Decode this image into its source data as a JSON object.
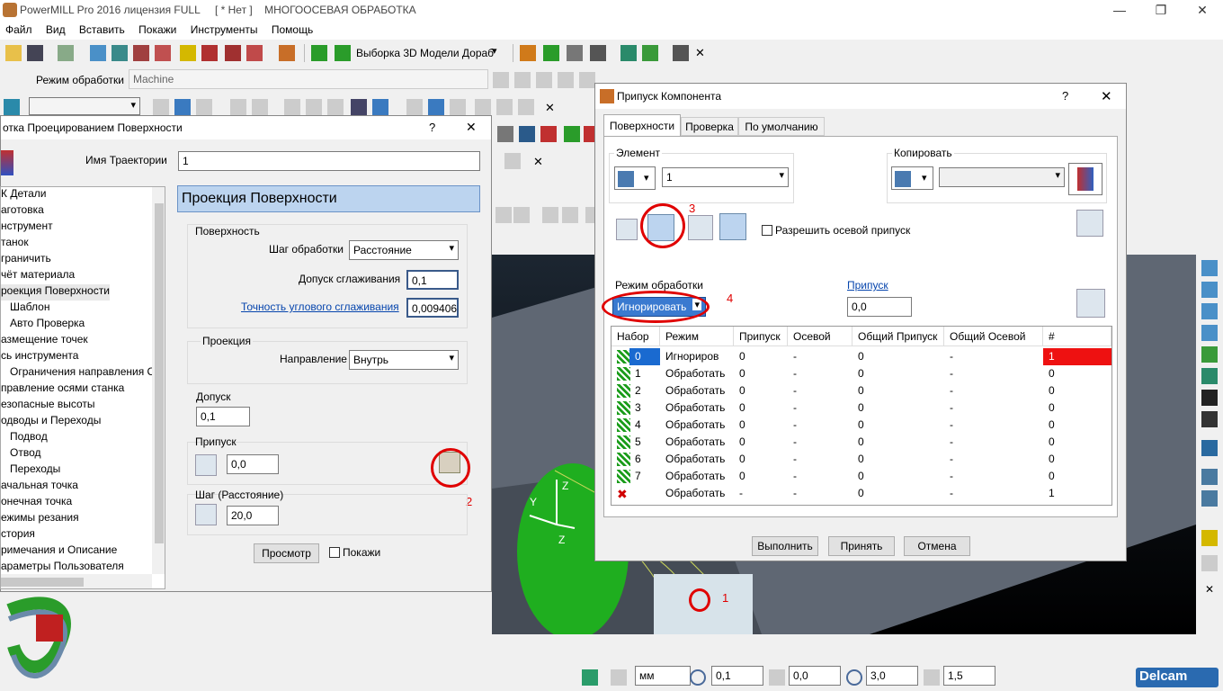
{
  "app": {
    "title": "PowerMILL Pro 2016 лицензия FULL     [ * Нет ]    МНОГООСЕВАЯ ОБРАБОТКА",
    "window_controls": [
      "—",
      "❐",
      "✕"
    ]
  },
  "menu": [
    "Файл",
    "Вид",
    "Вставить",
    "Покажи",
    "Инструменты",
    "Помощь"
  ],
  "toolbar1": {
    "model_select_label": "Выборка 3D Модели Дораб"
  },
  "toolbar2": {
    "mode_label": "Режим обработки",
    "mode_value": "Machine"
  },
  "left_dialog": {
    "title": "отка Проецированием Поверхности",
    "help": "?",
    "close": "✕",
    "trajectory_name_label": "Имя Траектории",
    "trajectory_name_value": "1",
    "panel_header": "Проекция Поверхности",
    "surface_group": "Поверхность",
    "step_label": "Шаг обработки",
    "step_value": "Расстояние",
    "smoothing_label": "Допуск сглаживания",
    "smoothing_value": "0,1",
    "angular_label": "Точность углового сглаживания",
    "angular_value": "0,009406",
    "projection_group": "Проекция",
    "direction_label": "Направление",
    "direction_value": "Внутрь",
    "tolerance_label": "Допуск",
    "tolerance_value": "0,1",
    "allowance_label": "Припуск",
    "allowance_value": "0,0",
    "stepover_label": "Шаг (Расстояние)",
    "stepover_value": "20,0",
    "preview_button": "Просмотр",
    "show_label": "Покажи",
    "annotation_2": "2"
  },
  "tree": [
    "К Детали",
    "аготовка",
    "нструмент",
    "танок",
    "граничить",
    "чёт материала",
    "роекция Поверхности",
    "Шаблон",
    "Авто Проверка",
    "азмещение точек",
    "сь инструмента",
    "Ограничения направления С",
    "правление осями станка",
    "езопасные высоты",
    "одводы и Переходы",
    "Подвод",
    "Отвод",
    "Переходы",
    "ачальная точка",
    "онечная точка",
    "ежимы резания",
    "стория",
    "римечания и Описание",
    "араметры Пользователя"
  ],
  "right_dialog": {
    "title": "Припуск Компонента",
    "help": "?",
    "close": "✕",
    "tabs": [
      "Поверхности",
      "Проверка",
      "По умолчанию"
    ],
    "element_label": "Элемент",
    "element_value": "1",
    "copy_label": "Копировать",
    "copy_value": "",
    "axial_checkbox": "Разрешить осевой припуск",
    "mode_label": "Режим обработки",
    "mode_value": "Игнорировать",
    "allowance_link": "Припуск",
    "allowance_value": "0,0",
    "annotation_3": "3",
    "annotation_4": "4",
    "columns": [
      "Набор",
      "Режим",
      "Припуск",
      "Осевой",
      "Общий Припуск",
      "Общий Осевой",
      "#"
    ],
    "rows": [
      [
        "0",
        "Игнориров",
        "0",
        "-",
        "0",
        "-",
        "1"
      ],
      [
        "1",
        "Обработать",
        "0",
        "-",
        "0",
        "-",
        "0"
      ],
      [
        "2",
        "Обработать",
        "0",
        "-",
        "0",
        "-",
        "0"
      ],
      [
        "3",
        "Обработать",
        "0",
        "-",
        "0",
        "-",
        "0"
      ],
      [
        "4",
        "Обработать",
        "0",
        "-",
        "0",
        "-",
        "0"
      ],
      [
        "5",
        "Обработать",
        "0",
        "-",
        "0",
        "-",
        "0"
      ],
      [
        "6",
        "Обработать",
        "0",
        "-",
        "0",
        "-",
        "0"
      ],
      [
        "7",
        "Обработать",
        "0",
        "-",
        "0",
        "-",
        "0"
      ],
      [
        "",
        "Обработать",
        "-",
        "-",
        "0",
        "-",
        "1"
      ]
    ],
    "btn_apply": "Выполнить",
    "btn_accept": "Принять",
    "btn_cancel": "Отмена"
  },
  "viewport": {
    "annotation_1": "1",
    "axis_y": "Y",
    "axis_z": "Z",
    "axis_z2": "Z"
  },
  "statusbar": {
    "units": "мм",
    "tol_value": "0,1",
    "allow_value": "0,0",
    "diam_value": "3,0",
    "len_value": "1,5",
    "brand": "Delcam"
  },
  "colors": {
    "accent_red": "#e00000",
    "green": "#1a9c1a",
    "panel_blue": "#bcd4ef"
  }
}
